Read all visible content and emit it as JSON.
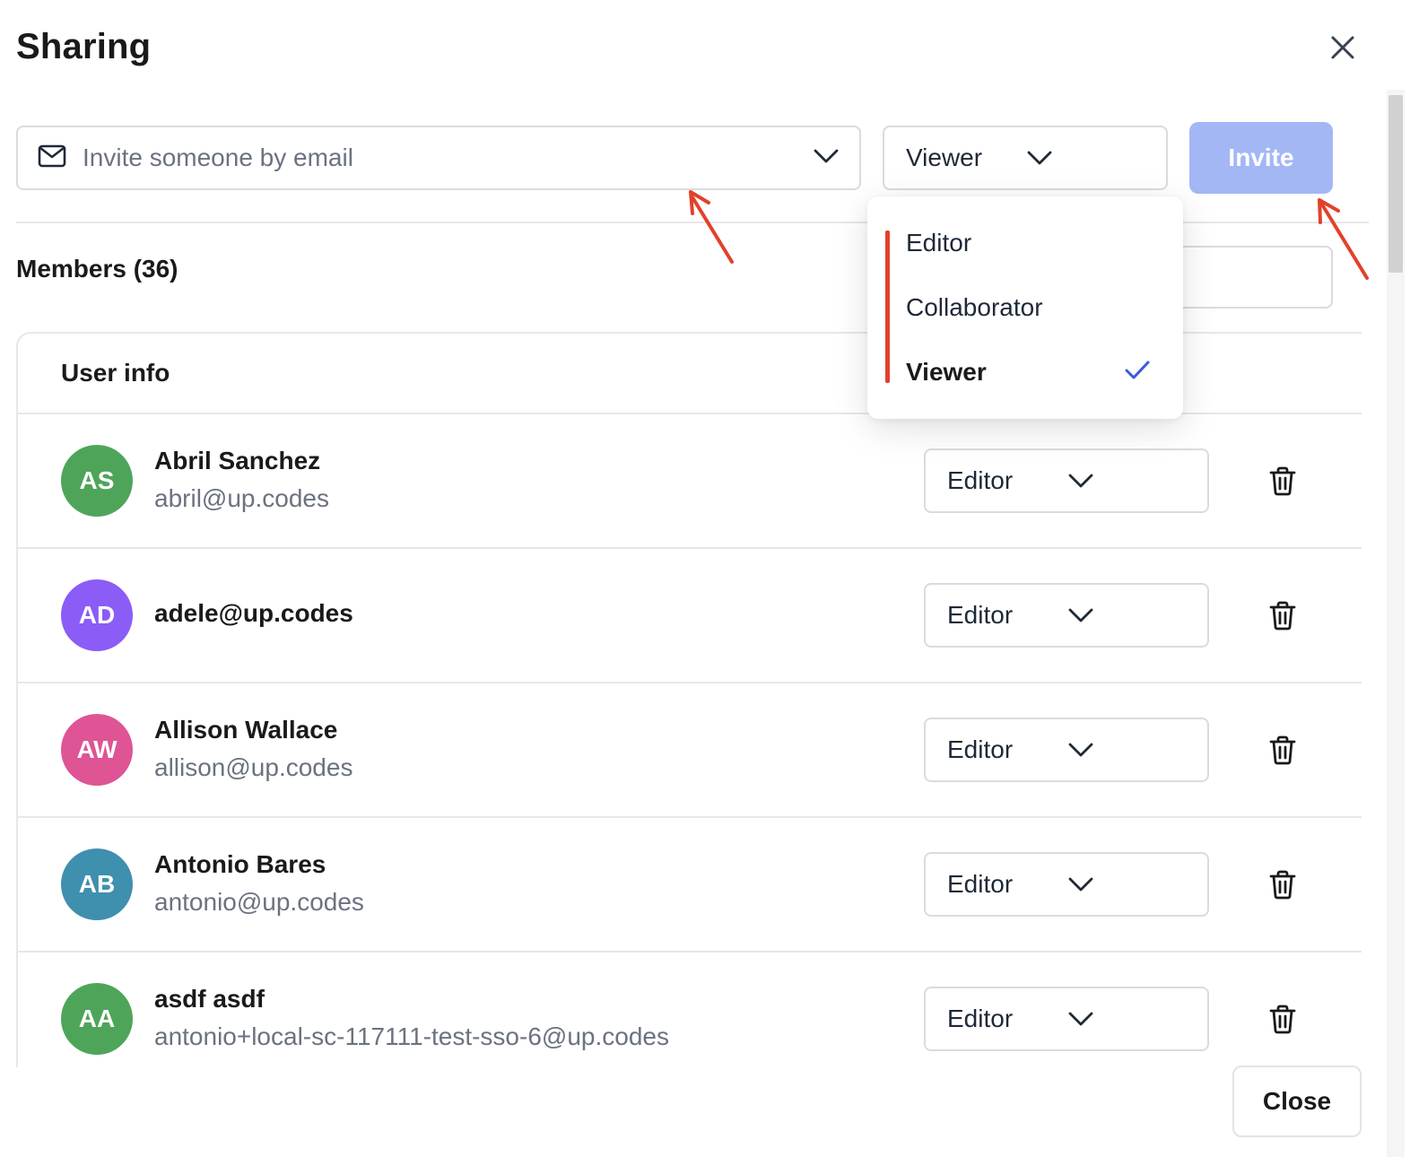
{
  "dialog": {
    "title": "Sharing",
    "close_icon": "close-icon"
  },
  "invite": {
    "placeholder": "Invite someone by email",
    "email_icon": "envelope-icon",
    "role_value": "Viewer",
    "button_label": "Invite"
  },
  "members": {
    "heading": "Members (36)",
    "column_header": "User info",
    "rows": [
      {
        "initials": "AS",
        "name": "Abril Sanchez",
        "email": "abril@up.codes",
        "role": "Editor",
        "avatar_color": "#4ea55a"
      },
      {
        "initials": "AD",
        "name": "adele@up.codes",
        "email": "",
        "role": "Editor",
        "avatar_color": "#8b5cf6"
      },
      {
        "initials": "AW",
        "name": "Allison Wallace",
        "email": "allison@up.codes",
        "role": "Editor",
        "avatar_color": "#de5495"
      },
      {
        "initials": "AB",
        "name": "Antonio Bares",
        "email": "antonio@up.codes",
        "role": "Editor",
        "avatar_color": "#3f8fae"
      },
      {
        "initials": "AA",
        "name": "asdf asdf",
        "email": "antonio+local-sc-117111-test-sso-6@up.codes",
        "role": "Editor",
        "avatar_color": "#4ea55a"
      }
    ]
  },
  "role_dropdown": {
    "options": [
      "Editor",
      "Collaborator",
      "Viewer"
    ],
    "selected": "Viewer"
  },
  "footer": {
    "close_label": "Close"
  },
  "colors": {
    "invite_button": "#a3b7f5",
    "checkmark": "#3a5bd9",
    "annotation": "#e2412c"
  }
}
